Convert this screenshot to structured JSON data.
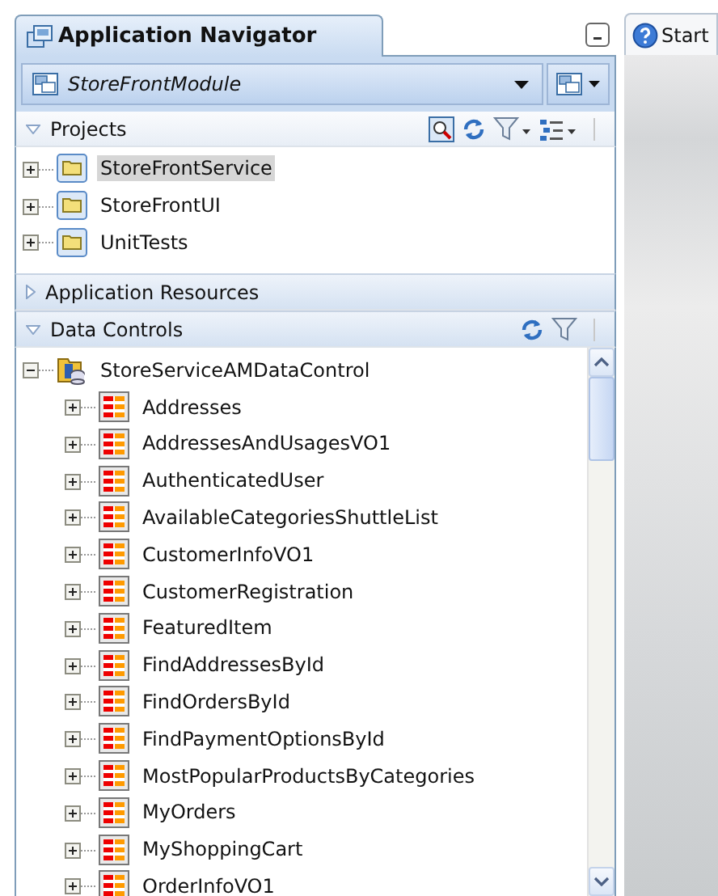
{
  "navigator": {
    "title": "Application Navigator",
    "module": "StoreFrontModule"
  },
  "sections": [
    {
      "title": "Projects",
      "expanded": true,
      "items": [
        {
          "label": "StoreFrontService",
          "kind": "project",
          "expanded": false,
          "selected": true
        },
        {
          "label": "StoreFrontUI",
          "kind": "project",
          "expanded": false,
          "selected": false
        },
        {
          "label": "UnitTests",
          "kind": "project",
          "expanded": false,
          "selected": false
        }
      ]
    },
    {
      "title": "Application Resources",
      "expanded": false
    },
    {
      "title": "Data Controls",
      "expanded": true,
      "items": [
        {
          "label": "StoreServiceAMDataControl",
          "kind": "datacontrol",
          "expanded": true,
          "selected": false,
          "children": [
            {
              "label": "Addresses",
              "kind": "collection",
              "expanded": false,
              "selected": false
            },
            {
              "label": "AddressesAndUsagesVO1",
              "kind": "collection",
              "expanded": false,
              "selected": false
            },
            {
              "label": "AuthenticatedUser",
              "kind": "collection",
              "expanded": false,
              "selected": false
            },
            {
              "label": "AvailableCategoriesShuttleList",
              "kind": "collection",
              "expanded": false,
              "selected": false
            },
            {
              "label": "CustomerInfoVO1",
              "kind": "collection",
              "expanded": false,
              "selected": false
            },
            {
              "label": "CustomerRegistration",
              "kind": "collection",
              "expanded": false,
              "selected": false
            },
            {
              "label": "FeaturedItem",
              "kind": "collection",
              "expanded": false,
              "selected": false
            },
            {
              "label": "FindAddressesById",
              "kind": "collection",
              "expanded": false,
              "selected": false
            },
            {
              "label": "FindOrdersById",
              "kind": "collection",
              "expanded": false,
              "selected": false
            },
            {
              "label": "FindPaymentOptionsById",
              "kind": "collection",
              "expanded": false,
              "selected": false
            },
            {
              "label": "MostPopularProductsByCategories",
              "kind": "collection",
              "expanded": false,
              "selected": false
            },
            {
              "label": "MyOrders",
              "kind": "collection",
              "expanded": false,
              "selected": false
            },
            {
              "label": "MyShoppingCart",
              "kind": "collection",
              "expanded": false,
              "selected": false
            },
            {
              "label": "OrderInfoVO1",
              "kind": "collection",
              "expanded": false,
              "selected": false
            }
          ]
        }
      ]
    }
  ],
  "editor_tab": {
    "label": "Start"
  }
}
